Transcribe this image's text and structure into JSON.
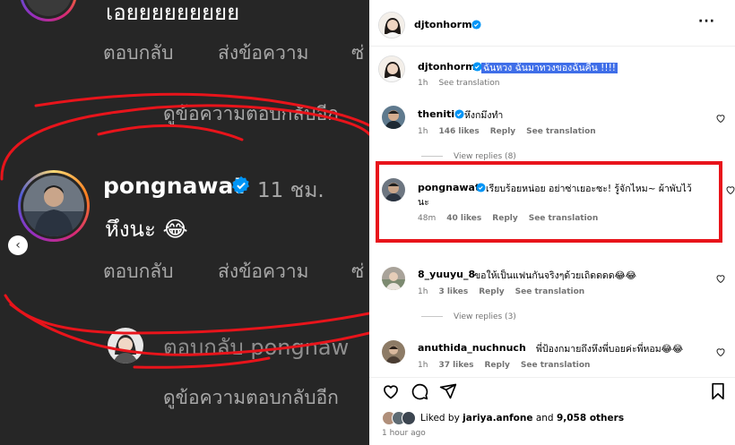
{
  "left": {
    "prev_comment_text": "เอยยยยยยยยย",
    "actions1": [
      "ตอบกลับ",
      "ส่งข้อความ",
      "ซ่"
    ],
    "view_replies": "ดูข้อความตอบกลับอีก",
    "username": "pongnawat",
    "time": "11 ชม.",
    "comment": "หึงนะ 😂",
    "actions2": [
      "ตอบกลับ",
      "ส่งข้อความ",
      "ซ่"
    ],
    "reply_to": "ตอบกลับ pongnaw",
    "view_replies2": "ดูข้อความตอบกลับอีก"
  },
  "post": {
    "owner": "djtonhorm",
    "caption_user": "djtonhorm",
    "caption_text": "ฉันหวง ฉันมาทวงของฉันคืน !!!!",
    "caption_time": "1h",
    "see_translation": "See translation",
    "more_label": "···"
  },
  "comments": [
    {
      "user": "theniti",
      "text": "หึงกมึงทำ",
      "time": "1h",
      "likes": "146 likes",
      "reply": "Reply",
      "translate": "See translation",
      "view_replies": "View replies (8)"
    },
    {
      "user": "pongnawat",
      "text": "เรียบร้อยหน่อย อย่าซ่าเยอะซะ! รู้จักไหม~ ผ้าพับไว้",
      "text2": "นะ",
      "time": "48m",
      "likes": "40 likes",
      "reply": "Reply",
      "translate": "See translation"
    },
    {
      "user": "8_yuuyu_8",
      "text": "ขอให้เป็นแฟนกันจริงๆด้วยเถิดดดด😂😂",
      "time": "1h",
      "likes": "3 likes",
      "reply": "Reply",
      "translate": "See translation",
      "view_replies": "View replies (3)"
    },
    {
      "user": "anuthida_nuchnuch",
      "text": "พี่ป้องกมายถึงหึงพี่บอยค่ะพี่หอม😂😂",
      "time": "1h",
      "likes": "37 likes",
      "reply": "Reply",
      "translate": "See translation"
    }
  ],
  "likes_line": {
    "prefix": "Liked by",
    "user": "jariya.anfone",
    "and": "and",
    "count": "9,058 others"
  },
  "posted": "1 hour ago",
  "colors": {
    "highlight": "#3f6ee8",
    "annotation_red": "#e8141b",
    "verified": "#0095f6"
  }
}
